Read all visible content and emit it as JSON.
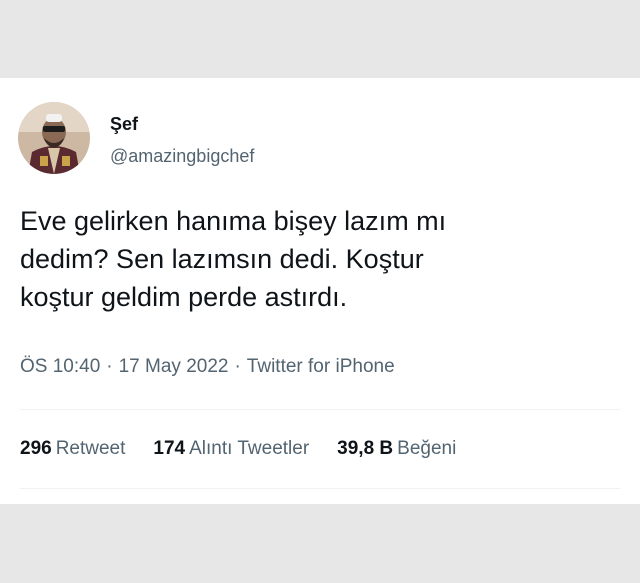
{
  "tweet": {
    "author": {
      "display_name": "Şef",
      "handle": "@amazingbigchef"
    },
    "text_lines": [
      "Eve gelirken hanıma bişey lazım mı",
      "dedim? Sen lazımsın dedi. Koştur",
      "koştur geldim perde astırdı."
    ],
    "time": "ÖS 10:40",
    "date": "17 May 2022",
    "source": "Twitter for iPhone",
    "separator": "·",
    "stats": {
      "retweets": {
        "count": "296",
        "label": "Retweet"
      },
      "quotes": {
        "count": "174",
        "label": "Alıntı Tweetler"
      },
      "likes": {
        "count": "39,8 B",
        "label": "Beğeni"
      }
    }
  },
  "colors": {
    "background": "#e7e7e7",
    "card": "#ffffff",
    "text_primary": "#0f1419",
    "text_secondary": "#536471",
    "divider": "#eff3f4"
  }
}
